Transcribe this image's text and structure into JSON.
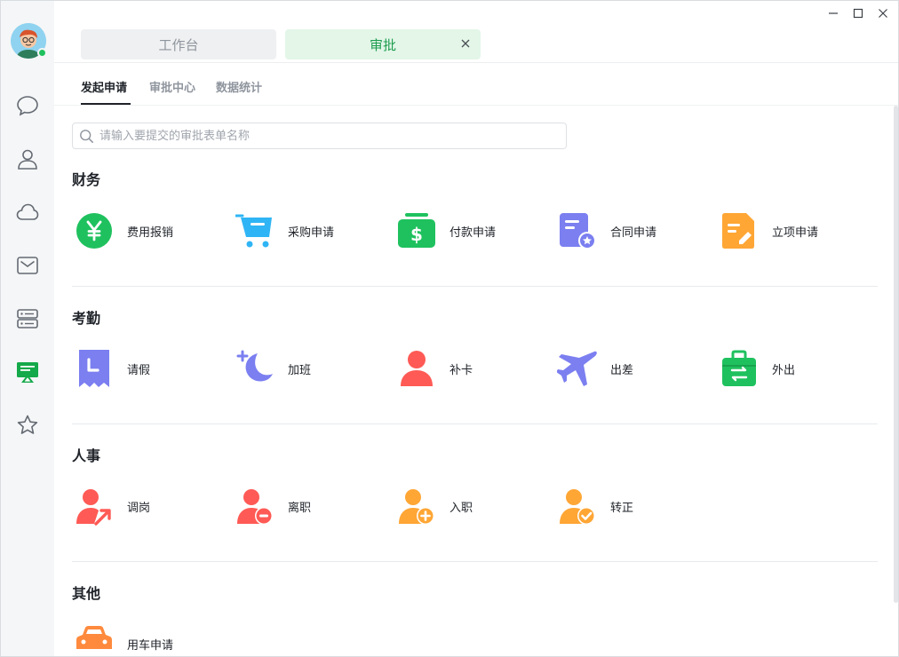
{
  "window": {
    "minimize_glyph": "—",
    "maximize_glyph": "☐",
    "close_glyph": "✕"
  },
  "sidebar": {
    "status": "online",
    "items": [
      {
        "icon": "chat-icon"
      },
      {
        "icon": "contacts-icon"
      },
      {
        "icon": "cloud-icon"
      },
      {
        "icon": "mail-icon"
      },
      {
        "icon": "storage-icon"
      },
      {
        "icon": "approval-icon",
        "active": true
      },
      {
        "icon": "star-icon"
      }
    ]
  },
  "tabs": [
    {
      "label": "工作台",
      "active": false
    },
    {
      "label": "审批",
      "active": true
    }
  ],
  "subtabs": [
    {
      "label": "发起申请",
      "active": true
    },
    {
      "label": "审批中心",
      "active": false
    },
    {
      "label": "数据统计",
      "active": false
    }
  ],
  "search": {
    "placeholder": "请输入要提交的审批表单名称",
    "value": ""
  },
  "sections": [
    {
      "title": "财务",
      "items": [
        {
          "label": "费用报销",
          "icon": "yen-coin-icon",
          "color": "#1fc15e"
        },
        {
          "label": "采购申请",
          "icon": "shopping-cart-icon",
          "color": "#2fb5f5"
        },
        {
          "label": "付款申请",
          "icon": "cash-icon",
          "color": "#1fc15e"
        },
        {
          "label": "合同申请",
          "icon": "contract-icon",
          "color": "#7b7ff0"
        },
        {
          "label": "立项申请",
          "icon": "project-doc-icon",
          "color": "#ffa635"
        }
      ]
    },
    {
      "title": "考勤",
      "items": [
        {
          "label": "请假",
          "icon": "leave-icon",
          "color": "#7b7ff0"
        },
        {
          "label": "加班",
          "icon": "moon-icon",
          "color": "#7b7ff0"
        },
        {
          "label": "补卡",
          "icon": "person-icon",
          "color": "#ff5a55"
        },
        {
          "label": "出差",
          "icon": "airplane-icon",
          "color": "#7b7ff0"
        },
        {
          "label": "外出",
          "icon": "briefcase-icon",
          "color": "#1fc15e"
        }
      ]
    },
    {
      "title": "人事",
      "items": [
        {
          "label": "调岗",
          "icon": "transfer-person-icon",
          "color": "#ff5a55"
        },
        {
          "label": "离职",
          "icon": "resign-person-icon",
          "color": "#ff5a55"
        },
        {
          "label": "入职",
          "icon": "onboard-person-icon",
          "color": "#ffa635"
        },
        {
          "label": "转正",
          "icon": "regular-person-icon",
          "color": "#ffa635"
        }
      ]
    },
    {
      "title": "其他",
      "items": [
        {
          "label": "用车申请",
          "icon": "car-icon",
          "color": "#ff8a3d"
        }
      ]
    }
  ]
}
